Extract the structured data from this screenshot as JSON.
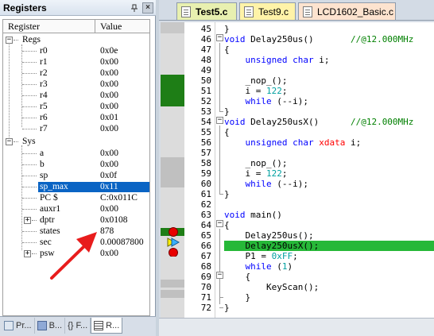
{
  "registers_panel": {
    "title": "Registers",
    "pin_icon": "pin-icon",
    "close_icon": "close-icon",
    "columns": {
      "name": "Register",
      "value": "Value"
    },
    "groups": [
      {
        "label": "Regs",
        "rows": [
          {
            "name": "r0",
            "value": "0x0e"
          },
          {
            "name": "r1",
            "value": "0x00"
          },
          {
            "name": "r2",
            "value": "0x00"
          },
          {
            "name": "r3",
            "value": "0x00"
          },
          {
            "name": "r4",
            "value": "0x00"
          },
          {
            "name": "r5",
            "value": "0x00"
          },
          {
            "name": "r6",
            "value": "0x01"
          },
          {
            "name": "r7",
            "value": "0x00"
          }
        ]
      },
      {
        "label": "Sys",
        "rows": [
          {
            "name": "a",
            "value": "0x00"
          },
          {
            "name": "b",
            "value": "0x00"
          },
          {
            "name": "sp",
            "value": "0x0f"
          },
          {
            "name": "sp_max",
            "value": "0x11",
            "selected": true
          },
          {
            "name": "PC  $",
            "value": "C:0x011C"
          },
          {
            "name": "auxr1",
            "value": "0x00"
          },
          {
            "name": "dptr",
            "value": "0x0108",
            "expandable": true
          },
          {
            "name": "states",
            "value": "878"
          },
          {
            "name": "sec",
            "value": "0.00087800"
          },
          {
            "name": "psw",
            "value": "0x00",
            "expandable": true
          }
        ]
      }
    ],
    "bottom_tabs": [
      {
        "label": "Pr...",
        "icon": "project-icon"
      },
      {
        "label": "B...",
        "icon": "books-icon"
      },
      {
        "label": "{} F...",
        "icon": "functions-icon"
      },
      {
        "label": "R...",
        "icon": "registers-icon",
        "active": true
      }
    ]
  },
  "editor": {
    "tabs": [
      {
        "label": "Test5.c",
        "color": "#e8f0b0",
        "active": true
      },
      {
        "label": "Test9.c",
        "color": "#fff3a8"
      },
      {
        "label": "LCD1602_Basic.c",
        "color": "#fde3cf"
      }
    ],
    "code": [
      {
        "n": "45",
        "t": "}"
      },
      {
        "n": "46",
        "t": "void Delay250us()       //@12.000MHz"
      },
      {
        "n": "47",
        "t": "{"
      },
      {
        "n": "48",
        "t": "    unsigned char i;"
      },
      {
        "n": "49",
        "t": ""
      },
      {
        "n": "50",
        "t": "    _nop_();"
      },
      {
        "n": "51",
        "t": "    i = 122;"
      },
      {
        "n": "52",
        "t": "    while (--i);"
      },
      {
        "n": "53",
        "t": "}"
      },
      {
        "n": "54",
        "t": "void Delay250usX()      //@12.000MHz"
      },
      {
        "n": "55",
        "t": "{"
      },
      {
        "n": "56",
        "t": "    unsigned char xdata i;"
      },
      {
        "n": "57",
        "t": ""
      },
      {
        "n": "58",
        "t": "    _nop_();"
      },
      {
        "n": "59",
        "t": "    i = 122;"
      },
      {
        "n": "60",
        "t": "    while (--i);"
      },
      {
        "n": "61",
        "t": "}"
      },
      {
        "n": "62",
        "t": ""
      },
      {
        "n": "63",
        "t": "void main()"
      },
      {
        "n": "64",
        "t": "{"
      },
      {
        "n": "65",
        "t": "    Delay250us();"
      },
      {
        "n": "66",
        "t": "    Delay250usX();"
      },
      {
        "n": "67",
        "t": "    P1 = 0xFF;"
      },
      {
        "n": "68",
        "t": "    while (1)"
      },
      {
        "n": "69",
        "t": "    {"
      },
      {
        "n": "70",
        "t": "        KeyScan();"
      },
      {
        "n": "71",
        "t": "    }"
      },
      {
        "n": "72",
        "t": "}"
      }
    ],
    "current_line": "66",
    "breakpoint_lines": [
      "65",
      "67"
    ]
  },
  "annotation": {
    "arrow_color": "#e81c1c",
    "arrow_icon": "red-arrow-icon"
  }
}
